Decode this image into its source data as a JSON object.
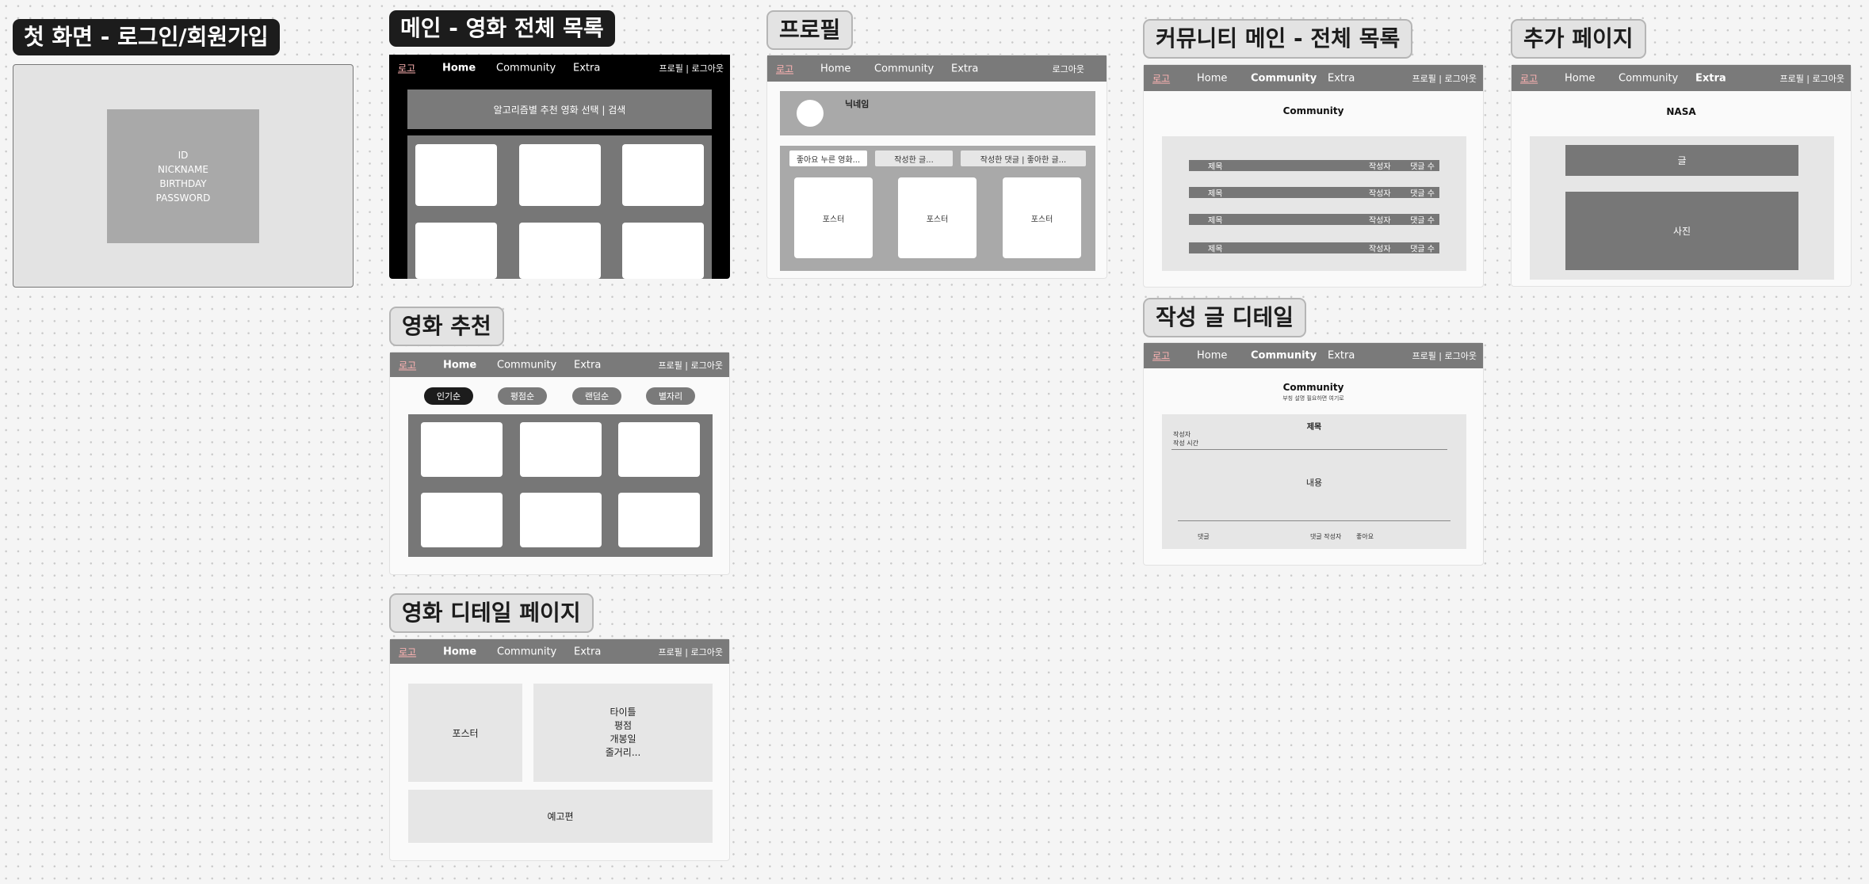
{
  "titles": {
    "login": "첫 화면 - 로그인/회원가입",
    "main": "메인 - 영화 전체 목록",
    "recommend": "영화 추천",
    "detail": "영화 디테일 페이지",
    "profile": "프로필",
    "community": "커뮤니티 메인 - 전체 목록",
    "post_detail": "작성 글 디테일",
    "extra": "추가 페이지"
  },
  "nav": {
    "logo": "로고",
    "home": "Home",
    "community": "Community",
    "extra": "Extra",
    "right": "프로필 | 로그아웃",
    "logout": "로그아웃"
  },
  "login": {
    "fields": [
      "ID",
      "NICKNAME",
      "BIRTHDAY",
      "PASSWORD"
    ]
  },
  "main": {
    "search_bar": "알고리즘별 추천 영화 선택 | 검색"
  },
  "recommend": {
    "sort_buttons": [
      "인기순",
      "평점순",
      "랜덤순",
      "별자리"
    ]
  },
  "movie_detail": {
    "poster": "포스터",
    "info": [
      "타이틀",
      "평점",
      "개봉일",
      "줄거리..."
    ],
    "trailer": "예고편"
  },
  "profile": {
    "nickname": "닉네임",
    "tabs": [
      "좋아요 누른 영화...",
      "작성한 글...",
      "작성한 댓글 | 좋아한 글..."
    ],
    "poster_label": "포스터"
  },
  "community": {
    "heading": "Community",
    "row": {
      "title": "제목",
      "author": "작성자",
      "comments": "댓글 수"
    }
  },
  "post": {
    "heading": "Community",
    "subheading": "부칭 설명 필요하면 여기로",
    "title": "제목",
    "author": "작성자",
    "time": "작성 시간",
    "content": "내용",
    "comment": "댓글",
    "comment_author": "댓글 작성자",
    "like": "좋아요"
  },
  "extra_page": {
    "heading": "NASA",
    "text_block": "글",
    "photo_block": "사진"
  }
}
